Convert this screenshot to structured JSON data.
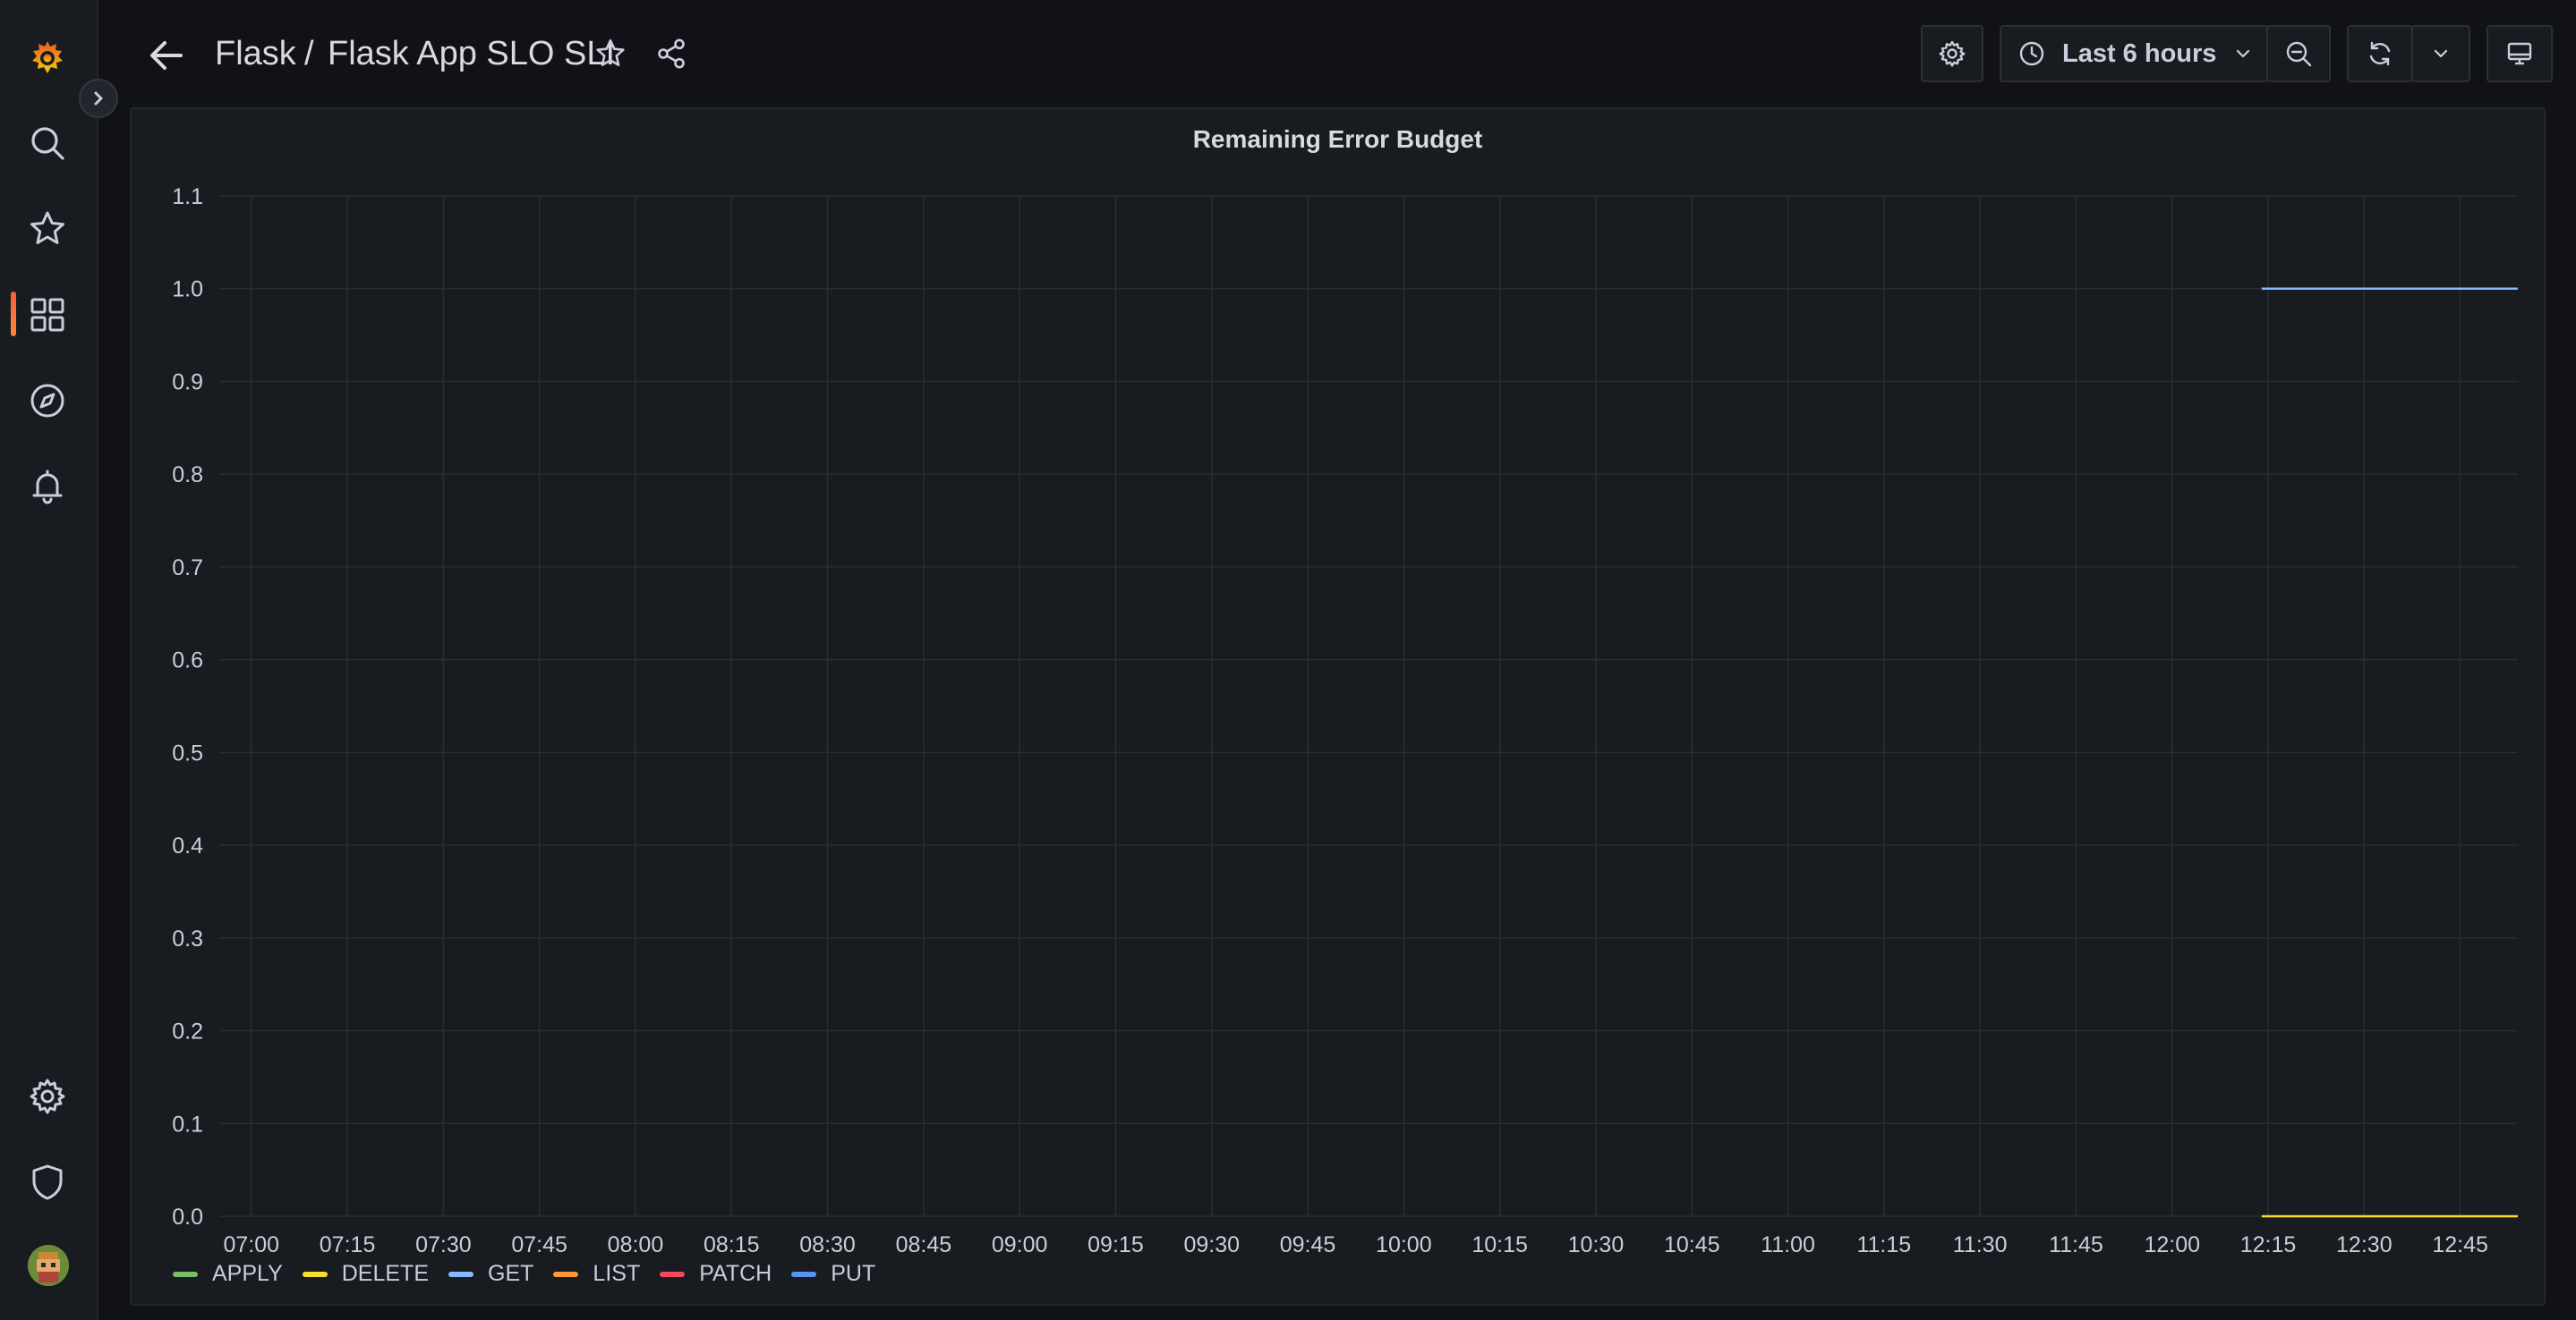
{
  "topbar": {
    "breadcrumb_folder": "Flask",
    "breadcrumb_sep": "/",
    "breadcrumb_dashboard": "Flask App SLO SLI",
    "time_range_label": "Last 6 hours"
  },
  "panel": {
    "title": "Remaining Error Budget"
  },
  "chart_data": {
    "type": "line",
    "title": "Remaining Error Budget",
    "xlabel": "",
    "ylabel": "",
    "x_ticks": [
      "07:00",
      "07:15",
      "07:30",
      "07:45",
      "08:00",
      "08:15",
      "08:30",
      "08:45",
      "09:00",
      "09:15",
      "09:30",
      "09:45",
      "10:00",
      "10:15",
      "10:30",
      "10:45",
      "11:00",
      "11:15",
      "11:30",
      "11:45",
      "12:00",
      "12:15",
      "12:30",
      "12:45"
    ],
    "y_ticks": [
      "0.0",
      "0.1",
      "0.2",
      "0.3",
      "0.4",
      "0.5",
      "0.6",
      "0.7",
      "0.8",
      "0.9",
      "1.0",
      "1.1"
    ],
    "xlim": [
      "06:55",
      "12:54"
    ],
    "ylim": [
      0,
      1.1
    ],
    "grid": true,
    "legend_placement": "bottom-left",
    "series": [
      {
        "name": "APPLY",
        "color": "#73bf69",
        "x": [],
        "values": []
      },
      {
        "name": "DELETE",
        "color": "#fade2a",
        "x": [
          "12:14",
          "12:54"
        ],
        "values": [
          0,
          0
        ]
      },
      {
        "name": "GET",
        "color": "#8ab8ff",
        "x": [
          "12:14",
          "12:54"
        ],
        "values": [
          1,
          1
        ]
      },
      {
        "name": "LIST",
        "color": "#ff9830",
        "x": [],
        "values": []
      },
      {
        "name": "PATCH",
        "color": "#f2495c",
        "x": [],
        "values": []
      },
      {
        "name": "PUT",
        "color": "#5794f2",
        "x": [],
        "values": []
      }
    ]
  }
}
